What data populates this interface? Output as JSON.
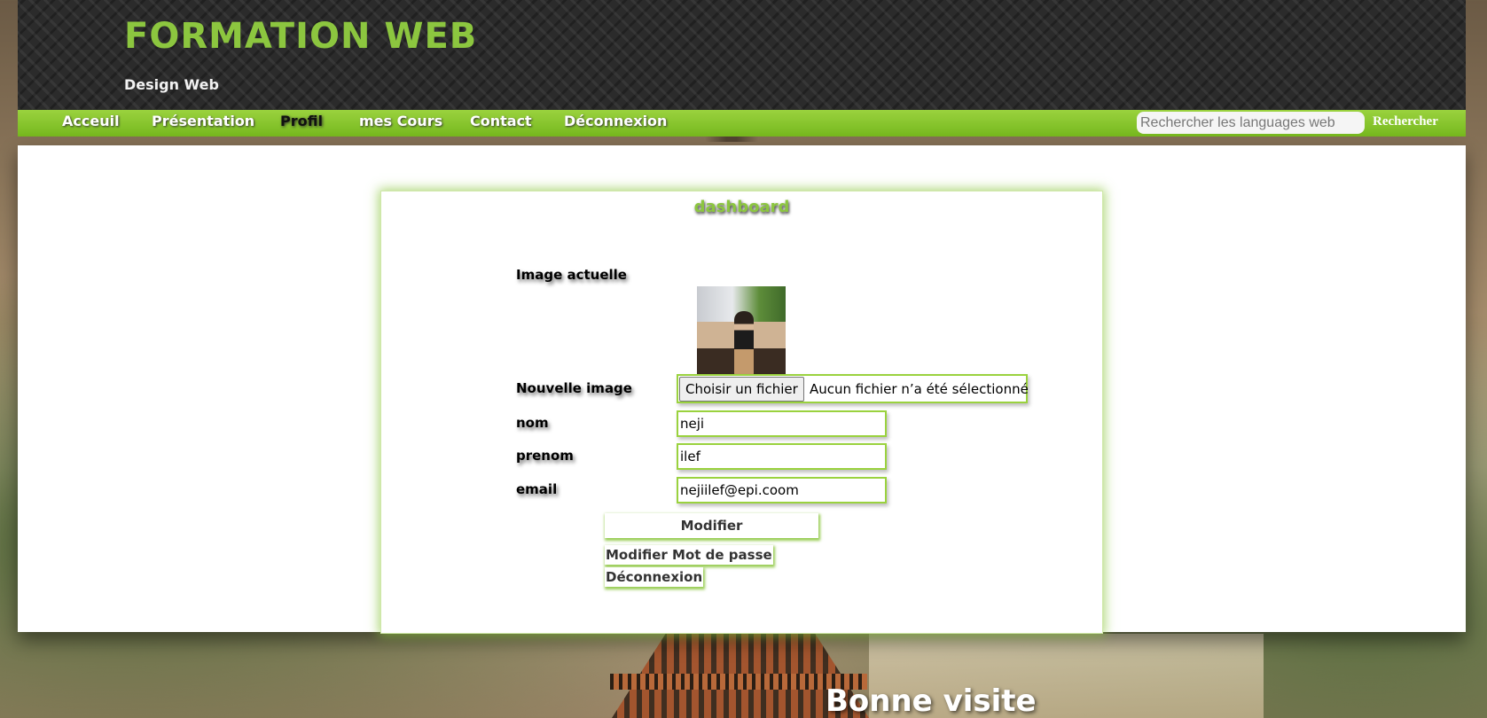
{
  "header": {
    "title": "FORMATION WEB",
    "subtitle": "Design Web"
  },
  "nav": {
    "items": [
      {
        "label": "Acceuil",
        "active": false
      },
      {
        "label": "Présentation",
        "active": false
      },
      {
        "label": "Profil",
        "active": true
      },
      {
        "label": "mes Cours",
        "active": false
      },
      {
        "label": "Contact",
        "active": false
      },
      {
        "label": "Déconnexion",
        "active": false
      }
    ],
    "search": {
      "placeholder": "Rechercher les languages web",
      "value": "",
      "button_label": "Rechercher"
    }
  },
  "dashboard": {
    "title": "dashboard",
    "current_image_label": "Image actuelle",
    "new_image_label": "Nouvelle image",
    "file_button_label": "Choisir un fichier",
    "file_status": "Aucun fichier n’a été sélectionné",
    "fields": {
      "nom": {
        "label": "nom",
        "value": "neji"
      },
      "prenom": {
        "label": "prenom",
        "value": "ilef"
      },
      "email": {
        "label": "email",
        "value": "nejiilef@epi.coom"
      }
    },
    "submit_label": "Modifier",
    "change_password_label": "Modifier Mot de passe",
    "logout_label": "Déconnexion"
  },
  "footer": {
    "text": "Bonne visite"
  },
  "colors": {
    "accent": "#8cc63f",
    "nav_bar": "#84c22b",
    "header_bg": "#2b2b2b",
    "panel_bg": "#ffffff"
  },
  "icons": {
    "avatar": "user-photo"
  }
}
